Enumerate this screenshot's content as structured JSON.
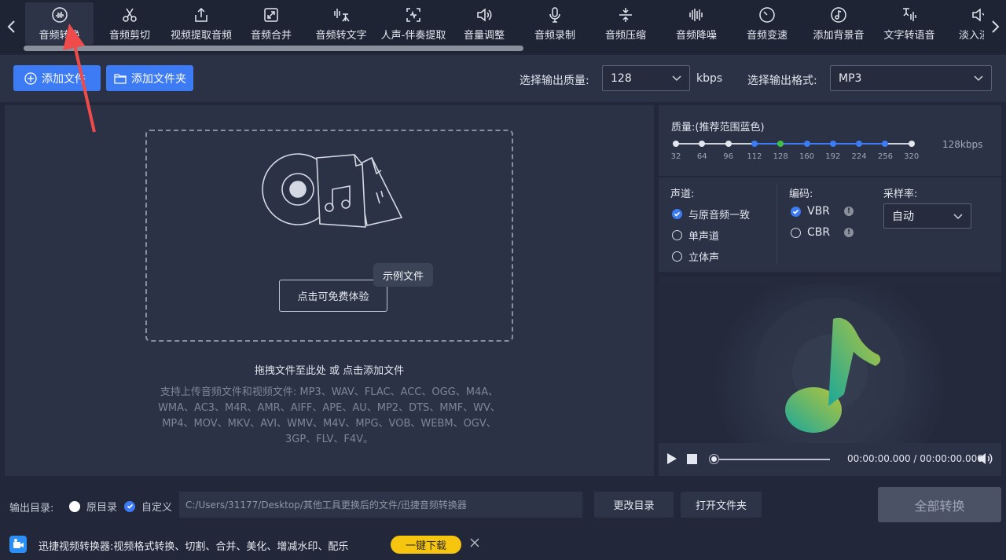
{
  "toolbar": {
    "tools": [
      {
        "label": "音频转换",
        "icon": "audio-convert-icon"
      },
      {
        "label": "音频剪切",
        "icon": "scissors-icon"
      },
      {
        "label": "视频提取音频",
        "icon": "export-icon"
      },
      {
        "label": "音频合并",
        "icon": "merge-icon"
      },
      {
        "label": "音频转文字",
        "icon": "speech-to-text-icon"
      },
      {
        "label": "人声-伴奏提取",
        "icon": "vocal-extract-icon"
      },
      {
        "label": "音量调整",
        "icon": "volume-icon"
      },
      {
        "label": "音频录制",
        "icon": "microphone-icon"
      },
      {
        "label": "音频压缩",
        "icon": "compress-icon"
      },
      {
        "label": "音频降噪",
        "icon": "denoise-icon"
      },
      {
        "label": "音频变速",
        "icon": "speed-icon"
      },
      {
        "label": "添加背景音",
        "icon": "background-music-icon"
      },
      {
        "label": "文字转语音",
        "icon": "text-to-speech-icon"
      },
      {
        "label": "淡入淡出",
        "icon": "fade-icon"
      }
    ]
  },
  "actions": {
    "add_file": "添加文件",
    "add_folder": "添加文件夹",
    "quality_label": "选择输出质量:",
    "quality_value": "128",
    "quality_unit": "kbps",
    "format_label": "选择输出格式:",
    "format_value": "MP3"
  },
  "dropzone": {
    "try_button": "点击可免费体验",
    "sample_tag": "示例文件",
    "title": "拖拽文件至此处 或 点击添加文件",
    "supported": "支持上传音频文件和视频文件: MP3、WAV、FLAC、ACC、OGG、M4A、WMA、AC3、M4R、AMR、AIFF、APE、AU、MP2、DTS、MMF、WV、MP4、MOV、MKV、AVI、WMV、M4V、MPG、VOB、WEBM、OGV、3GP、FLV、F4V。"
  },
  "settings": {
    "quality_title": "质量:(推荐范围蓝色)",
    "quality_ticks": [
      "32",
      "64",
      "96",
      "112",
      "128",
      "160",
      "192",
      "224",
      "256",
      "320"
    ],
    "quality_selected": "128",
    "quality_display": "128kbps",
    "channel_title": "声道:",
    "channel_options": [
      "与原音频一致",
      "单声道",
      "立体声"
    ],
    "encoding_title": "编码:",
    "encoding_options": [
      "VBR",
      "CBR"
    ],
    "samplerate_title": "采样率:",
    "samplerate_value": "自动"
  },
  "player": {
    "time": "00:00:00.000 / 00:00:00.000"
  },
  "output": {
    "label": "输出目录:",
    "opt_original": "原目录",
    "opt_custom": "自定义",
    "path": "C:/Users/31177/Desktop/其他工具更换后的文件/迅捷音频转换器",
    "change_dir": "更改目录",
    "open_folder": "打开文件夹",
    "convert_all": "全部转换"
  },
  "ad": {
    "text": "迅捷视频转换器:视频格式转换、切割、合并、美化、增减水印、配乐",
    "download": "一键下载"
  },
  "colors": {
    "accent": "#3c7bf4",
    "background": "#22283a",
    "panel": "#2b3245",
    "download_yellow": "#f5c50f",
    "quality_selected_green": "#3fbf3f"
  }
}
